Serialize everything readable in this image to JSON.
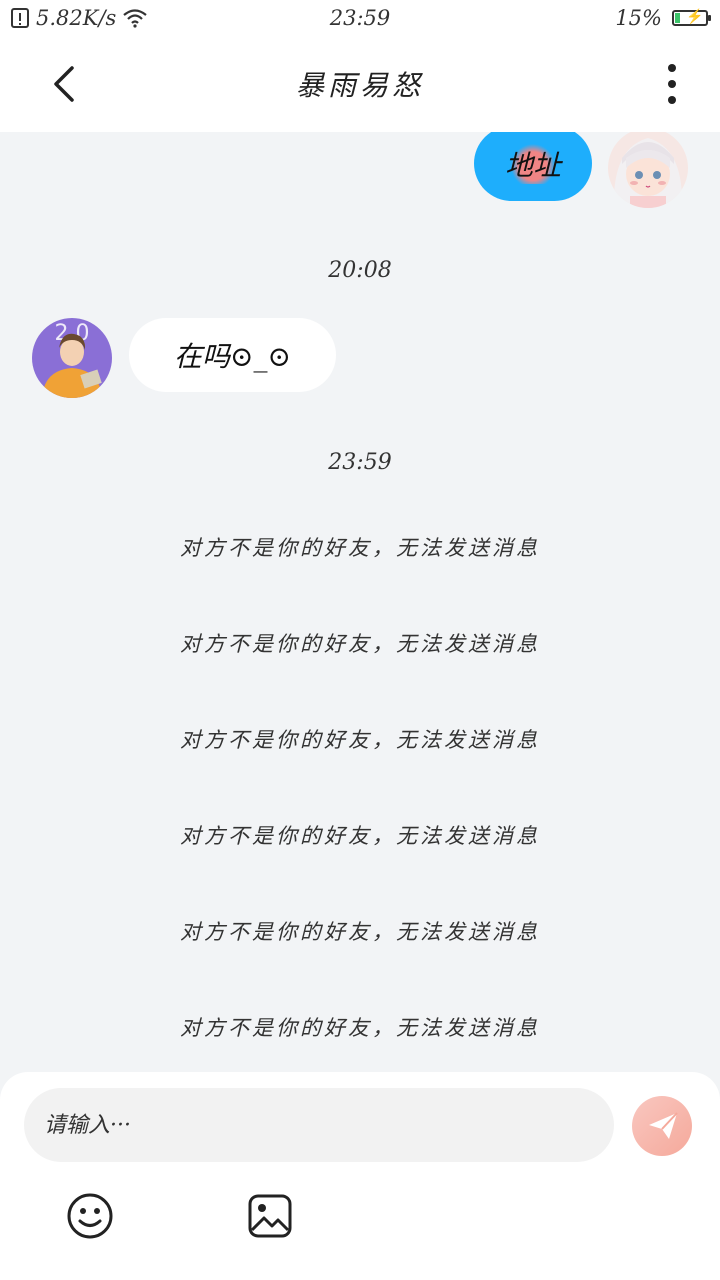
{
  "status_bar": {
    "network_speed": "5.82K/s",
    "time": "23:59",
    "battery_text": "15%",
    "battery_level": 0.15
  },
  "header": {
    "title": "暴雨易怒"
  },
  "messages": [
    {
      "sender": "me",
      "text": "地址"
    },
    {
      "timestamp": "20:08"
    },
    {
      "sender": "contact",
      "text": "在吗⊙_⊙"
    },
    {
      "timestamp": "23:59"
    }
  ],
  "system_notice": "对方不是你的好友，无法发送消息",
  "system_notice_count": 6,
  "input": {
    "placeholder": "请输入···"
  },
  "colors": {
    "sent_bubble": "#1eaefc",
    "received_bubble": "#ffffff",
    "background": "#f2f4f6",
    "send_button": "#f5a99b"
  },
  "icons": [
    "back-icon",
    "more-vertical-icon",
    "emoji-icon",
    "image-icon",
    "send-icon",
    "wifi-icon",
    "battery-icon",
    "sim-alert-icon"
  ]
}
